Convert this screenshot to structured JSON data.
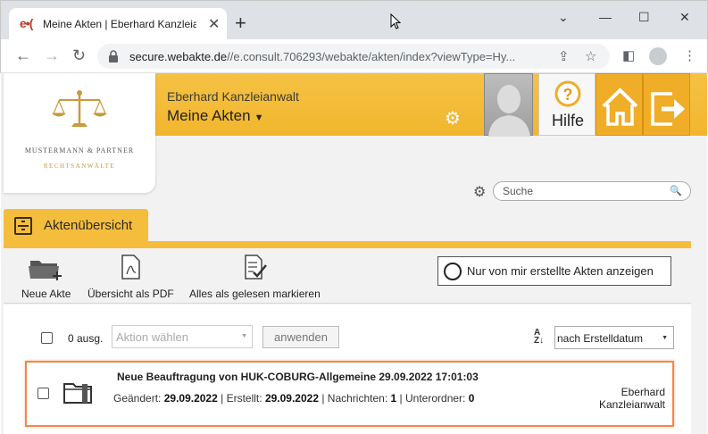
{
  "browser": {
    "tab_title": "Meine Akten | Eberhard Kanzleianwalt",
    "url_host": "secure.webakte.de",
    "url_path": "//e.consult.706293/webakte/akten/index?viewType=Hy..."
  },
  "header": {
    "user_name": "Eberhard Kanzleianwalt",
    "page_title": "Meine Akten",
    "help_label": "Hilfe"
  },
  "logo": {
    "line1": "MUSTERMANN & PARTNER",
    "line2": "RECHTSANWÄLTE"
  },
  "search": {
    "placeholder": "Suche"
  },
  "section": {
    "title": "Aktenübersicht"
  },
  "actions": {
    "new_file": "Neue Akte",
    "overview_pdf": "Übersicht als PDF",
    "mark_all_read": "Alles als gelesen markieren",
    "only_mine": "Nur von mir erstellte Akten anzeigen"
  },
  "bulk": {
    "selected_count": "0 ausg.",
    "action_placeholder": "Aktion wählen",
    "apply_label": "anwenden",
    "sort_value": "nach Erstelldatum"
  },
  "records": [
    {
      "title": "Neue Beauftragung von HUK-COBURG-Allgemeine 29.09.2022 17:01:03",
      "changed_label": "Geändert:",
      "changed": "29.09.2022",
      "created_label": "Erstellt:",
      "created": "29.09.2022",
      "messages_label": "Nachrichten:",
      "messages": "1",
      "subfolders_label": "Unterordner:",
      "subfolders": "0",
      "owner_line1": "Eberhard",
      "owner_line2": "Kanzleianwalt"
    }
  ],
  "colors": {
    "accent": "#f5bd3c",
    "header": "#f1b62d",
    "highlight_border": "#ef8a4a"
  }
}
